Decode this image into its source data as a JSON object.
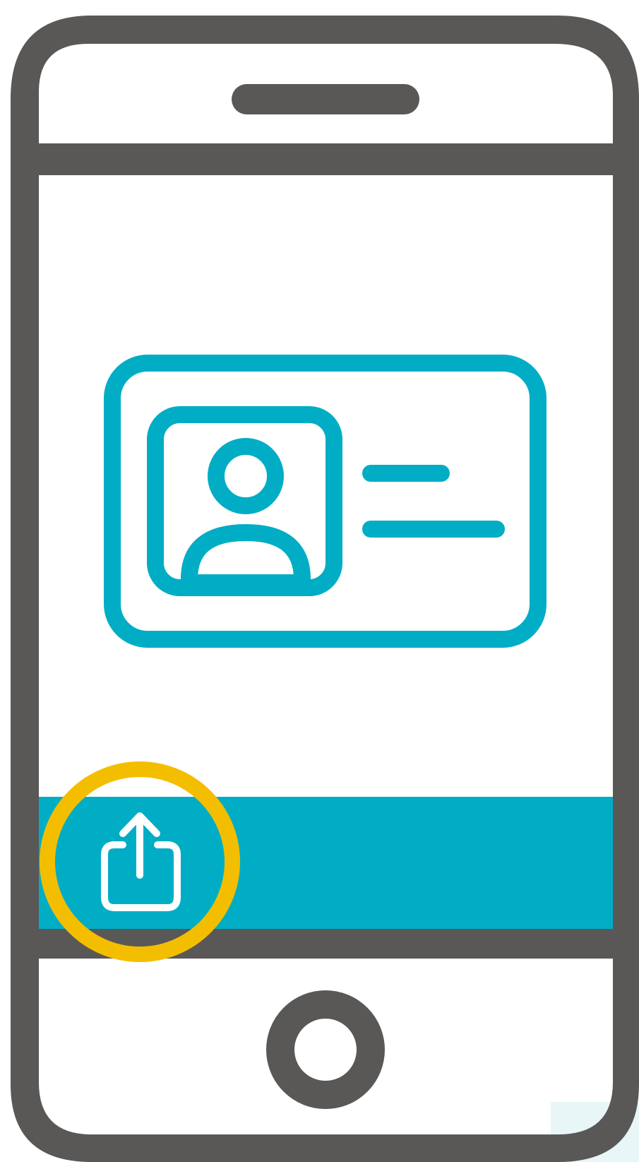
{
  "colors": {
    "phone_frame": "#595856",
    "accent": "#00adc5",
    "highlight_ring": "#f4be00",
    "screen_background": "#ffffff",
    "share_glyph": "#ffffff"
  },
  "icons": {
    "earpiece": "speaker-slot-icon",
    "id_card": "id-card-icon",
    "share": "share-icon",
    "home_button": "home-button-icon"
  },
  "id_card": {
    "text_lines": 2
  },
  "action_bar": {
    "highlighted_action": "share"
  }
}
